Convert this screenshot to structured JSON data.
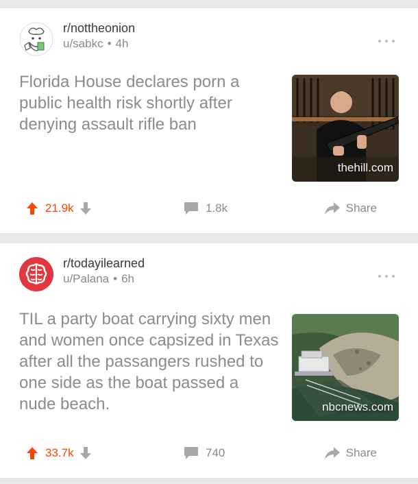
{
  "posts": [
    {
      "subreddit": "r/nottheonion",
      "user": "u/sabkc",
      "age": "4h",
      "title": "Florida House declares porn a public health risk shortly after denying assault rifle ban",
      "domain": "thehill.com",
      "score": "21.9k",
      "comments": "1.8k",
      "share_label": "Share",
      "avatar_icon": "onion-chef-icon"
    },
    {
      "subreddit": "r/todayilearned",
      "user": "u/Palana",
      "age": "6h",
      "title": "TIL a party boat carrying sixty men and women once capsized in Texas after all the passangers rushed to one side as the boat passed a nude beach.",
      "domain": "nbcnews.com",
      "score": "33.7k",
      "comments": "740",
      "share_label": "Share",
      "avatar_icon": "brain-icon"
    }
  ],
  "colors": {
    "upvote": "#ff4500",
    "muted": "#8a8a8a",
    "background": "#e9e9e9"
  }
}
